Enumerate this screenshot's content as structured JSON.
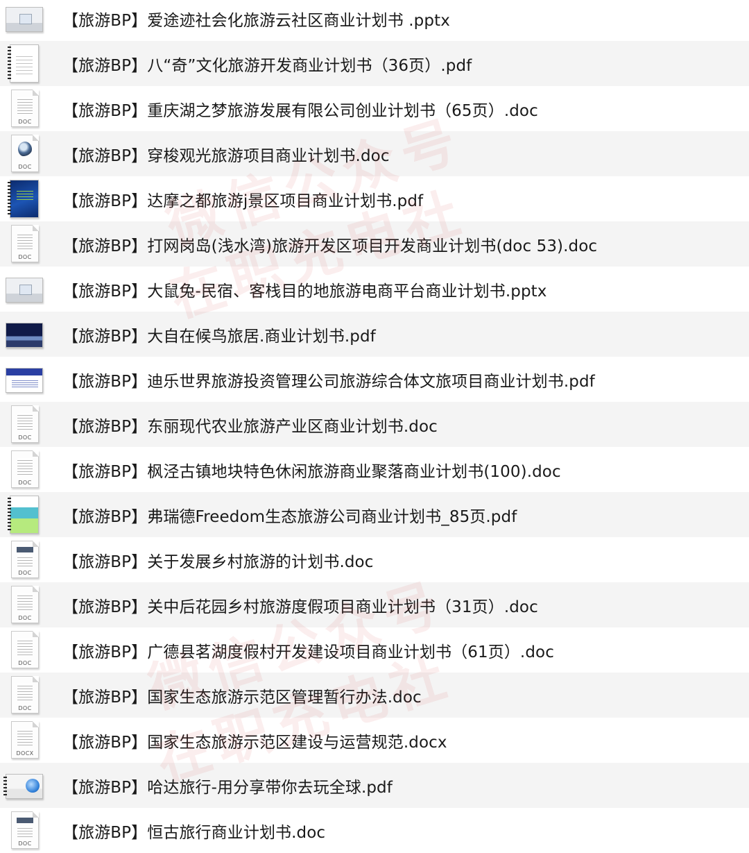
{
  "files": [
    {
      "name": "【旅游BP】爱途迹社会化旅游云社区商业计划书 .pptx",
      "icon": "slide-gray"
    },
    {
      "name": "【旅游BP】八“奇”文化旅游开发商业计划书（36页）.pdf",
      "icon": "spiral-plain"
    },
    {
      "name": "【旅游BP】重庆湖之梦旅游发展有限公司创业计划书（65页）.doc",
      "icon": "doc"
    },
    {
      "name": "【旅游BP】穿梭观光旅游项目商业计划书.doc",
      "icon": "doc-photo"
    },
    {
      "name": "【旅游BP】达摩之都旅游j景区项目商业计划书.pdf",
      "icon": "spiral-blue"
    },
    {
      "name": "【旅游BP】打网岗岛(浅水湾)旅游开发区项目开发商业计划书(doc 53).doc",
      "icon": "doc"
    },
    {
      "name": "【旅游BP】大鼠兔-民宿、客栈目的地旅游电商平台商业计划书.pptx",
      "icon": "slide-gray"
    },
    {
      "name": "【旅游BP】大自在候鸟旅居.商业计划书.pdf",
      "icon": "slide-night"
    },
    {
      "name": "【旅游BP】迪乐世界旅游投资管理公司旅游综合体文旅项目商业计划书.pdf",
      "icon": "slide-bluehdr"
    },
    {
      "name": "【旅游BP】东丽现代农业旅游产业区商业计划书.doc",
      "icon": "doc"
    },
    {
      "name": "【旅游BP】枫泾古镇地块特色休闲旅游商业聚落商业计划书(100).doc",
      "icon": "doc"
    },
    {
      "name": "【旅游BP】弗瑞德Freedom生态旅游公司商业计划书_85页.pdf",
      "icon": "spiral-teal"
    },
    {
      "name": "【旅游BP】关于发展乡村旅游的计划书.doc",
      "icon": "doc-bar"
    },
    {
      "name": "【旅游BP】关中后花园乡村旅游度假项目商业计划书（31页）.doc",
      "icon": "doc"
    },
    {
      "name": "【旅游BP】广德县茗湖度假村开发建设项目商业计划书（61页）.doc",
      "icon": "doc"
    },
    {
      "name": "【旅游BP】国家生态旅游示范区管理暂行办法.doc",
      "icon": "doc"
    },
    {
      "name": "【旅游BP】国家生态旅游示范区建设与运营规范.docx",
      "icon": "docx"
    },
    {
      "name": "【旅游BP】哈达旅行-用分享带你去玩全球.pdf",
      "icon": "slide-light"
    },
    {
      "name": "【旅游BP】恒古旅行商业计划书.doc",
      "icon": "doc-bar"
    }
  ],
  "doc_label": "DOC",
  "docx_label": "DOCX",
  "watermark": {
    "line1": "微信公众号",
    "line2": "在职充电社"
  }
}
